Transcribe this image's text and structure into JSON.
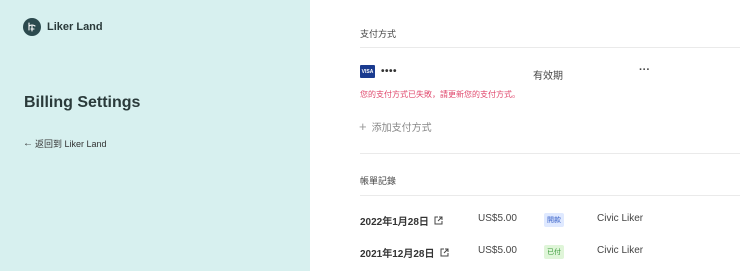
{
  "sidebar": {
    "brand_name": "Liker Land",
    "title": "Billing Settings",
    "back_arrow": "←",
    "back_label": "返回到 Liker Land"
  },
  "payment": {
    "section_title": "支付方式",
    "card_brand": "VISA",
    "card_dots": "••••",
    "validity_label": "有效期",
    "more_label": "···",
    "error_message": "您的支付方式已失敗，請更新您的支付方式。",
    "add_label": "添加支付方式"
  },
  "billing": {
    "section_title": "帳單記錄",
    "records": [
      {
        "date": "2022年1月28日",
        "amount": "US$5.00",
        "status": "開款",
        "status_color": "#dfe9ff",
        "status_text_color": "#3b63c9",
        "plan": "Civic Liker"
      },
      {
        "date": "2021年12月28日",
        "amount": "US$5.00",
        "status": "已付",
        "status_color": "#dff5d8",
        "status_text_color": "#3a9a3a",
        "plan": "Civic Liker"
      }
    ]
  }
}
